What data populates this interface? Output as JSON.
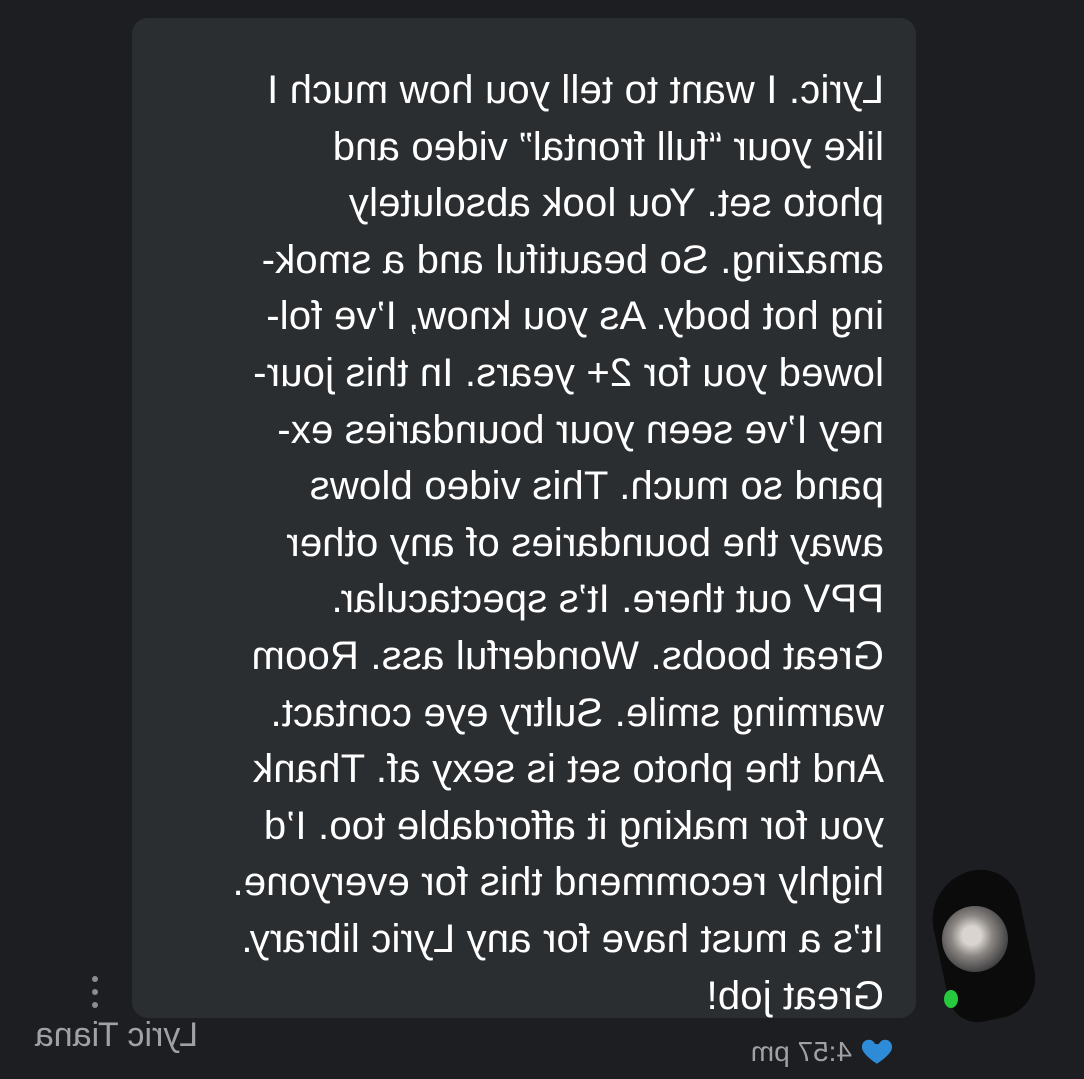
{
  "message": {
    "lines": [
      "Lyric. I want to tell you how much I",
      "like your “full frontal” video and",
      "photo set. You look absolutely",
      "amazing. So beautiful and a smok-",
      "ing hot body. As you know, I’ve fol-",
      "lowed you for 2+ years. In this jour-",
      "ney I’ve seen your boundaries ex-",
      "pand so much. This video blows",
      "away the boundaries of any other",
      "PPV out there. It’s spectacular.",
      "Great boobs. Wonderful ass. Room",
      "warming smile. Sultry eye contact.",
      "And the photo set is sexy af. Thank",
      "you for making it affordable too. I’d",
      "highly recommend this for everyone.",
      "It’s a must have for any Lyric library.",
      "Great job!"
    ],
    "timestamp": "4:57 pm",
    "sender": "Lyric Tiana"
  },
  "icons": {
    "menu": "vertical-dots-icon",
    "like": "heart-icon",
    "status": "online-dot-icon"
  },
  "colors": {
    "background": "#1c1e21",
    "bubble": "#2b2e31",
    "text": "#ffffff",
    "muted": "#9ea2a7",
    "heart": "#2e8bd8",
    "online": "#27c93f"
  }
}
